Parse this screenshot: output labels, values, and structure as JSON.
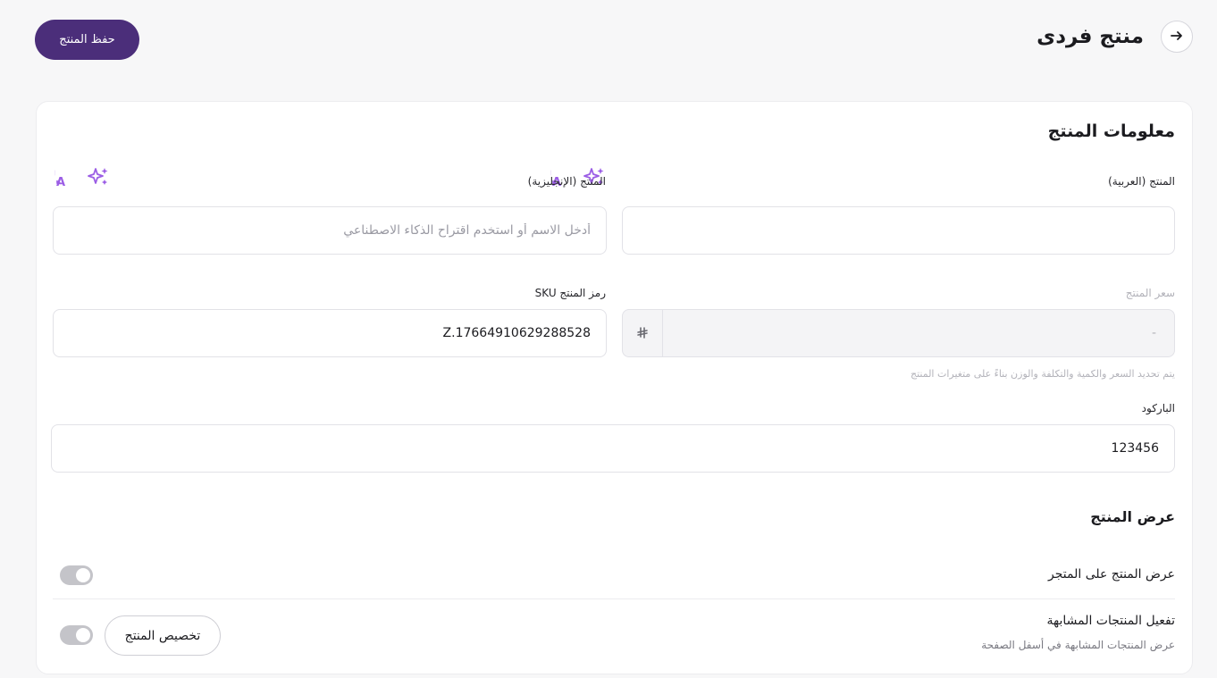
{
  "header": {
    "title": "منتج فردى",
    "save_label": "حفظ المنتج"
  },
  "product_info": {
    "section_title": "معلومات المنتج",
    "name_ar": {
      "label": "المنتج (العربية)",
      "value": ""
    },
    "name_en": {
      "label": "المنتج (الإنجليزية)",
      "placeholder": "أدخل الاسم أو استخدم اقتراح الذكاء الاصطناعي",
      "value": ""
    },
    "price": {
      "label": "سعر المنتج",
      "value": "-",
      "currency_symbol": "⃁",
      "hint": "يتم تحديد السعر والكمية والتكلفة والوزن بناءً على متغيرات المنتج"
    },
    "sku": {
      "label": "رمز المنتج SKU",
      "value": "Z.17664910629288528"
    },
    "barcode": {
      "label": "الباركود",
      "value": "123456"
    }
  },
  "display": {
    "section_title": "عرض المنتج",
    "show_in_store": {
      "label": "عرض المنتج على المتجر",
      "enabled": false
    },
    "similar_products": {
      "label": "تفعيل المنتجات المشابهة",
      "description": "عرض المنتجات المشابهة في أسفل الصفحة",
      "customize_label": "تخصيص المنتج",
      "enabled": false
    }
  },
  "colors": {
    "primary": "#4b2e7a",
    "ai_icon": "#9b5de5",
    "toggle_off": "#c4c4c9"
  },
  "icons": [
    "arrow-right-icon",
    "sparkles-icon",
    "translate-icon",
    "riyal-icon"
  ]
}
